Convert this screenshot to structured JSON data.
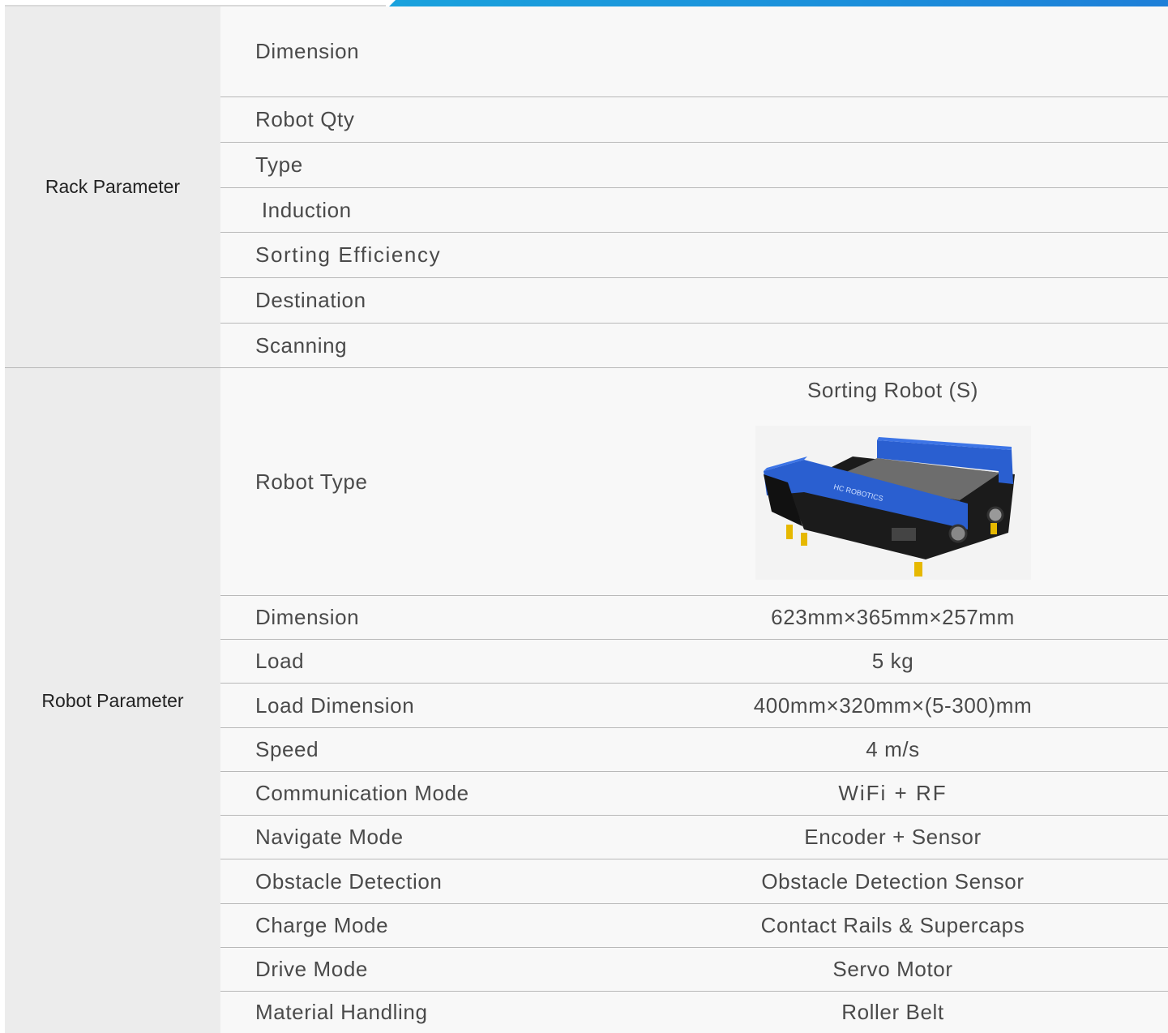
{
  "rack": {
    "label": "Rack Parameter",
    "rows": [
      {
        "name": "Dimension",
        "value": ""
      },
      {
        "name": "Robot Qty",
        "value": ""
      },
      {
        "name": "Type",
        "value": ""
      },
      {
        "name": " Induction",
        "value": ""
      },
      {
        "name": "Sorting Efficiency",
        "value": ""
      },
      {
        "name": "Destination",
        "value": ""
      },
      {
        "name": "Scanning",
        "value": ""
      }
    ]
  },
  "robot": {
    "label": "Robot Parameter",
    "type_row": {
      "name": "Robot Type",
      "title": "Sorting Robot (S)",
      "image_caption": "HC ROBOTICS"
    },
    "rows": [
      {
        "name": "Dimension",
        "value": "623mm×365mm×257mm"
      },
      {
        "name": "Load",
        "value": "5 kg"
      },
      {
        "name": "Load Dimension",
        "value": "400mm×320mm×(5-300)mm"
      },
      {
        "name": "Speed",
        "value": "4 m/s"
      },
      {
        "name": "Communication Mode",
        "value": "WiFi + RF"
      },
      {
        "name": "Navigate Mode",
        "value": "Encoder + Sensor"
      },
      {
        "name": "Obstacle Detection",
        "value": "Obstacle Detection Sensor"
      },
      {
        "name": "Charge Mode",
        "value": "Contact Rails & Supercaps"
      },
      {
        "name": "Drive Mode",
        "value": "Servo Motor"
      },
      {
        "name": "Material Handling",
        "value": "Roller Belt"
      }
    ]
  },
  "colors": {
    "accent": "#1c8fdb",
    "robot_blue": "#2a5fd0"
  }
}
